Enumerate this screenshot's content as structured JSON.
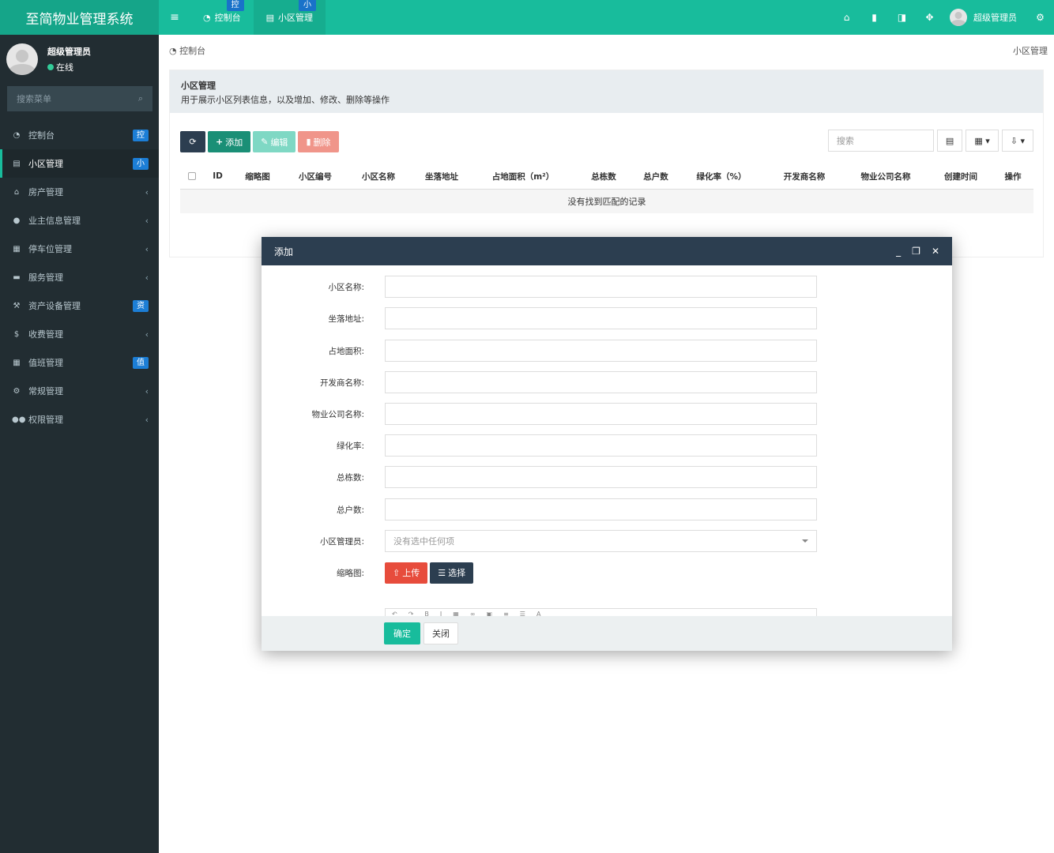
{
  "header": {
    "brand": "至简物业管理系统",
    "tabs": [
      {
        "label": "控制台",
        "badge": "控"
      },
      {
        "label": "小区管理",
        "badge": "小"
      }
    ],
    "user_name": "超级管理员"
  },
  "sidebar": {
    "user_name": "超级管理员",
    "status": "在线",
    "search_placeholder": "搜索菜单",
    "items": [
      {
        "label": "控制台",
        "badge": "控"
      },
      {
        "label": "小区管理",
        "badge": "小"
      },
      {
        "label": "房产管理"
      },
      {
        "label": "业主信息管理"
      },
      {
        "label": "停车位管理"
      },
      {
        "label": "服务管理"
      },
      {
        "label": "资产设备管理",
        "badge": "资"
      },
      {
        "label": "收费管理"
      },
      {
        "label": "值班管理",
        "badge": "值"
      },
      {
        "label": "常规管理"
      },
      {
        "label": "权限管理"
      }
    ]
  },
  "breadcrumb": {
    "left": "控制台",
    "right": "小区管理"
  },
  "panel": {
    "title": "小区管理",
    "description": "用于展示小区列表信息，以及增加、修改、删除等操作"
  },
  "toolbar": {
    "add": "添加",
    "edit": "编辑",
    "delete": "删除",
    "search_placeholder": "搜索"
  },
  "table": {
    "columns": [
      "ID",
      "缩略图",
      "小区编号",
      "小区名称",
      "坐落地址",
      "占地面积（m²）",
      "总栋数",
      "总户数",
      "绿化率（%）",
      "开发商名称",
      "物业公司名称",
      "创建时间",
      "操作"
    ],
    "empty_text": "没有找到匹配的记录"
  },
  "modal": {
    "title": "添加",
    "fields": [
      {
        "label": "小区名称:"
      },
      {
        "label": "坐落地址:"
      },
      {
        "label": "占地面积:"
      },
      {
        "label": "开发商名称:"
      },
      {
        "label": "物业公司名称:"
      },
      {
        "label": "绿化率:"
      },
      {
        "label": "总栋数:"
      },
      {
        "label": "总户数:"
      }
    ],
    "manager_label": "小区管理员:",
    "manager_placeholder": "没有选中任何项",
    "thumb_label": "缩略图:",
    "upload": "上传",
    "choose": "选择",
    "ok": "确定",
    "close": "关闭"
  },
  "colors": {
    "primary": "#18bc9c",
    "dark": "#2c3e50",
    "sidebar": "#222d32",
    "danger": "#e74c3c",
    "badge": "#1c7ed6"
  }
}
